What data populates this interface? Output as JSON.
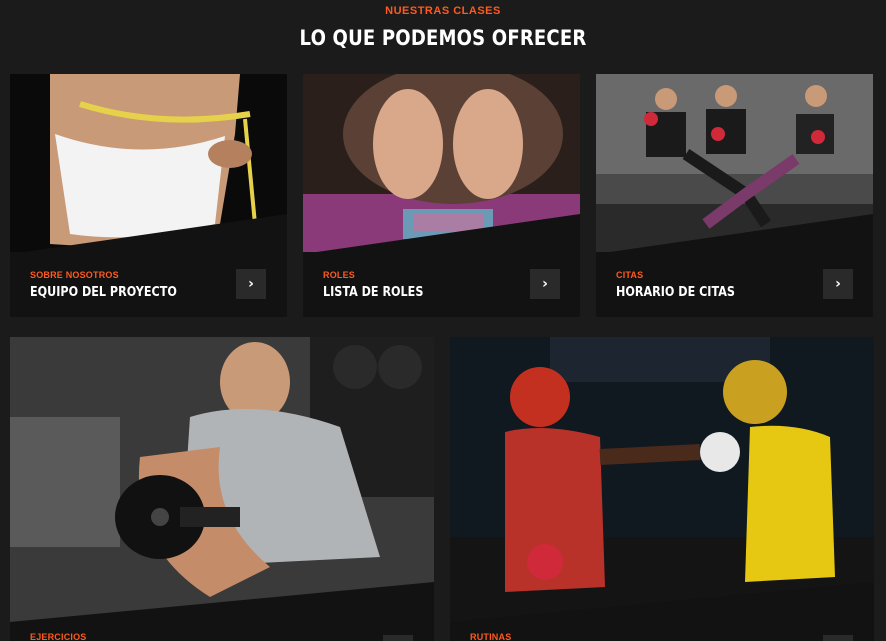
{
  "section": {
    "eyebrow": "NUESTRAS CLASES",
    "title": "LO QUE PODEMOS OFRECER"
  },
  "accent_color": "#ff5a1f",
  "cards": [
    {
      "category": "SOBRE NOSOTROS",
      "title": "EQUIPO DEL PROYECTO",
      "image": "fitness-measuring-tape-photo",
      "button_icon": "chevron-right-icon"
    },
    {
      "category": "ROLES",
      "title": "LISTA DE ROLES",
      "image": "yoga-stretch-feet-photo",
      "button_icon": "chevron-right-icon"
    },
    {
      "category": "CITAS",
      "title": "HORARIO DE CITAS",
      "image": "group-abs-workout-photo",
      "button_icon": "chevron-right-icon"
    },
    {
      "category": "EJERCICIOS",
      "title": "",
      "image": "dumbbell-curl-photo",
      "button_icon": "chevron-right-icon"
    },
    {
      "category": "RUTINAS",
      "title": "",
      "image": "boxing-match-photo",
      "button_icon": "chevron-right-icon"
    }
  ]
}
